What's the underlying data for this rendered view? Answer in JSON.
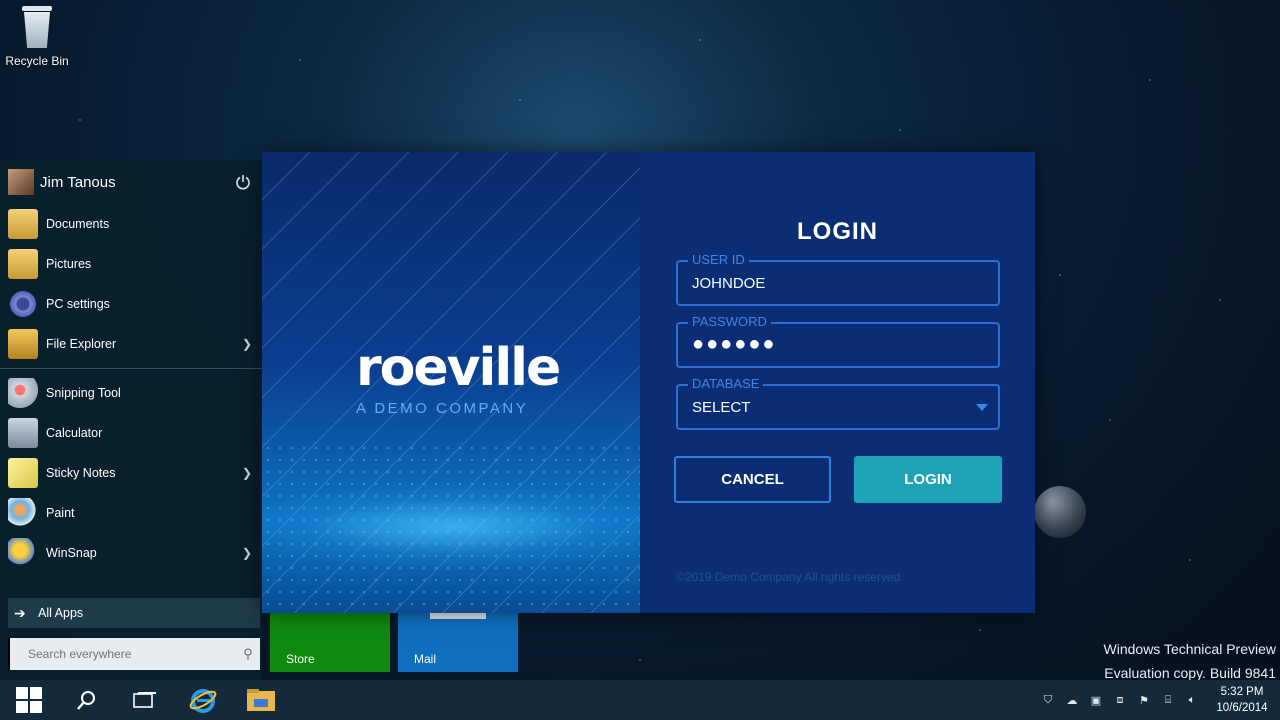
{
  "desktop": {
    "recycle_bin_label": "Recycle Bin",
    "watermark_line1": "Windows Technical Preview",
    "watermark_line2": "Evaluation copy. Build 9841"
  },
  "start_menu": {
    "user_name": "Jim Tanous",
    "items": [
      {
        "label": "Documents",
        "icon": "documents-folder-icon",
        "has_submenu": false
      },
      {
        "label": "Pictures",
        "icon": "pictures-folder-icon",
        "has_submenu": false
      },
      {
        "label": "PC settings",
        "icon": "gear-icon",
        "has_submenu": false
      },
      {
        "label": "File Explorer",
        "icon": "file-explorer-icon",
        "has_submenu": true
      },
      {
        "label": "Snipping Tool",
        "icon": "snipping-tool-icon",
        "has_submenu": false
      },
      {
        "label": "Calculator",
        "icon": "calculator-icon",
        "has_submenu": false
      },
      {
        "label": "Sticky Notes",
        "icon": "sticky-notes-icon",
        "has_submenu": true
      },
      {
        "label": "Paint",
        "icon": "paint-icon",
        "has_submenu": false
      },
      {
        "label": "WinSnap",
        "icon": "winsnap-icon",
        "has_submenu": true
      }
    ],
    "all_apps_label": "All Apps",
    "search_placeholder": "Search everywhere",
    "tiles": [
      {
        "label": "Store",
        "color": "#0f8a0f"
      },
      {
        "label": "Mail",
        "color": "#0e6fbf"
      }
    ]
  },
  "login": {
    "brand_name": "roeville",
    "brand_tagline": "A DEMO COMPANY",
    "title": "LOGIN",
    "user_id_label": "USER ID",
    "user_id_value": "JOHNDOE",
    "password_label": "PASSWORD",
    "password_value": "●●●●●●",
    "database_label": "DATABASE",
    "database_value": "SELECT",
    "cancel_label": "CANCEL",
    "login_label": "LOGIN",
    "copyright": "©2019 Demo Company All rights reserved",
    "colors": {
      "panel": "#0a2d74",
      "accent": "#2e6fd6",
      "login_button": "#1ea3b6"
    }
  },
  "taskbar": {
    "time": "5:32 PM",
    "date": "10/6/2014"
  }
}
